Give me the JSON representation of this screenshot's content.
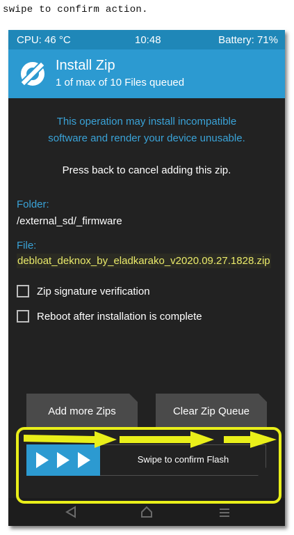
{
  "caption": "swipe to confirm action.",
  "status": {
    "cpu": "CPU: 46 °C",
    "time": "10:48",
    "battery": "Battery: 71%"
  },
  "header": {
    "title": "Install Zip",
    "subtitle": "1 of max of 10 Files queued"
  },
  "warning": {
    "line1": "This operation may install incompatible",
    "line2": "software and render your device unusable."
  },
  "back_notice": "Press back to cancel adding this zip.",
  "folder": {
    "label": "Folder:",
    "value": "/external_sd/_firmware"
  },
  "file": {
    "label": "File:",
    "value": "debloat_deknox_by_eladkarako_v2020.09.27.1828.zip"
  },
  "options": [
    {
      "label": "Zip signature verification",
      "checked": false
    },
    {
      "label": "Reboot after installation is complete",
      "checked": false
    }
  ],
  "buttons": {
    "add": "Add more Zips",
    "clear": "Clear Zip Queue"
  },
  "swipe": {
    "label": "Swipe to confirm Flash"
  },
  "nav": {
    "back_icon": "back-triangle-icon",
    "home_icon": "home-icon",
    "menu_icon": "menu-lines-icon"
  },
  "colors": {
    "accent": "#2c9ad1",
    "status_bar": "#1f87b8",
    "background": "#222222",
    "warning_text": "#3aa3d8",
    "highlight": "#e9ef1a",
    "file_text": "#eaea6a"
  }
}
